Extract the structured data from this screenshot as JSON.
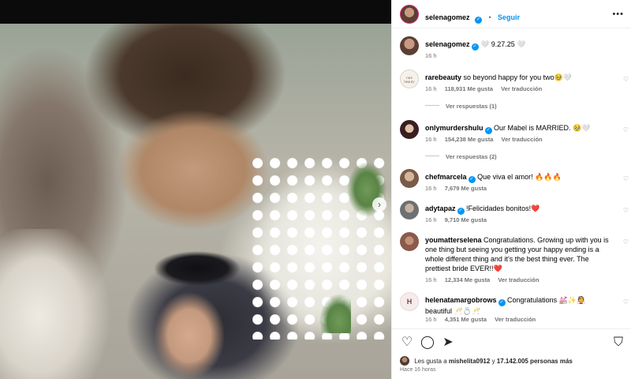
{
  "post": {
    "username": "selenagomez",
    "follow_label": "Seguir",
    "more_label": "•••",
    "next_label": "›"
  },
  "caption": {
    "username": "selenagomez",
    "text": "🤍 9.27.25 🤍",
    "time": "16 h"
  },
  "comments": [
    {
      "username": "rarebeauty",
      "verified": false,
      "avatar_text": "rare beauty",
      "text": "so beyond happy for you two🥹🤍",
      "time": "16 h",
      "likes": "118,931 Me gusta",
      "translate": "Ver traducción",
      "replies": "Ver respuestas (1)"
    },
    {
      "username": "onlymurdershulu",
      "verified": true,
      "text": "Our Mabel is MARRIED. 🥹🤍",
      "time": "16 h",
      "likes": "154,238 Me gusta",
      "translate": "Ver traducción",
      "replies": "Ver respuestas (2)"
    },
    {
      "username": "chefmarcela",
      "verified": true,
      "text": "Que viva el amor! 🔥🔥🔥",
      "time": "16 h",
      "likes": "7,679 Me gusta",
      "translate": "",
      "replies": ""
    },
    {
      "username": "adytapaz",
      "verified": true,
      "text": "!Felicidades bonitos!❤️",
      "time": "16 h",
      "likes": "9,710 Me gusta",
      "translate": "",
      "replies": ""
    },
    {
      "username": "youmatterselena",
      "verified": false,
      "text": "Congratulations. Growing up with you is one thing but seeing you getting your happy ending is a whole different thing and it’s the best thing ever. The prettiest bride EVER!!❤️",
      "time": "16 h",
      "likes": "12,334 Me gusta",
      "translate": "Ver traducción",
      "replies": ""
    },
    {
      "username": "helenatamargobrows",
      "verified": true,
      "avatar_text": "H",
      "text": "Congratulations 💒✨👰 beautiful 🥂💍🥂",
      "time": "16 h",
      "likes": "4,351 Me gusta",
      "translate": "Ver traducción",
      "replies": ""
    }
  ],
  "footer": {
    "likes_prefix": "Les gusta a",
    "likes_user": "mishelita0912",
    "likes_joiner": "y",
    "likes_count": "17.142.005 personas más",
    "time_ago": "Hace 16 horas"
  },
  "colors": {
    "accent": "#0095f6",
    "text_secondary": "#737373"
  }
}
